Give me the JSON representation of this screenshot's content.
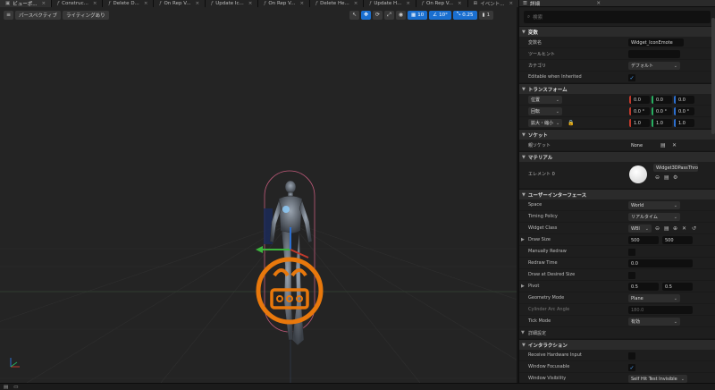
{
  "tabs": [
    {
      "label": "ビューポ...",
      "active": true,
      "icon": "viewport-icon"
    },
    {
      "label": "Construc...",
      "icon": "function-icon"
    },
    {
      "label": "Delete D...",
      "icon": "function-icon"
    },
    {
      "label": "On Rep V...",
      "icon": "function-icon"
    },
    {
      "label": "Update Ic...",
      "icon": "function-icon"
    },
    {
      "label": "On Rep V...",
      "icon": "function-icon"
    },
    {
      "label": "Delete He...",
      "icon": "function-icon"
    },
    {
      "label": "Update H...",
      "icon": "function-icon"
    },
    {
      "label": "On Rep V...",
      "icon": "function-icon"
    },
    {
      "label": "イベント...",
      "icon": "event-graph-icon"
    }
  ],
  "viewport": {
    "perspective_label": "パースペクティブ",
    "lighting_label": "ライティングあり",
    "grid_snap": "10",
    "rotation_snap": "10°",
    "scale_snap": "0.25",
    "camera_speed": "1"
  },
  "details": {
    "tab_label": "詳細",
    "search_placeholder": "検索",
    "sections": {
      "variables": "変数",
      "transform": "トランスフォーム",
      "socket": "ソケット",
      "material": "マテリアル",
      "user_interface": "ユーザーインターフェース",
      "interaction": "インタラクション"
    },
    "variable_name_label": "変数名",
    "variable_name_value": "Widget_IconEmote",
    "tooltip_label": "ツールヒント",
    "category_label": "カテゴリ",
    "category_value": "デフォルト",
    "editable_label": "Editable when Inherited",
    "location_label": "位置",
    "location": [
      "0.0",
      "0.0",
      "0.0"
    ],
    "rotation_label": "回転",
    "rotation": [
      "0.0 °",
      "0.0 °",
      "0.0 °"
    ],
    "scale_label": "拡大・縮小",
    "scale": [
      "1.0",
      "1.0",
      "1.0"
    ],
    "parent_socket_label": "親ソケット",
    "parent_socket_value": "None",
    "element0_label": "エレメント 0",
    "material_value": "Widget3DPassThro",
    "space_label": "Space",
    "space_value": "World",
    "timing_label": "Timing Policy",
    "timing_value": "リアルタイム",
    "widget_class_label": "Widget Class",
    "widget_class_value": "WBI",
    "draw_size_label": "Draw Size",
    "draw_size": [
      "500",
      "500"
    ],
    "manual_redraw_label": "Manually Redraw",
    "redraw_time_label": "Redraw Time",
    "redraw_time_value": "0.0",
    "draw_desired_label": "Draw at Desired Size",
    "pivot_label": "Pivot",
    "pivot": [
      "0.5",
      "0.5"
    ],
    "geometry_mode_label": "Geometry Mode",
    "geometry_mode_value": "Plane",
    "cylinder_arc_label": "Cylinder Arc Angle",
    "cylinder_arc_value": "180.0",
    "tick_mode_label": "Tick Mode",
    "tick_mode_value": "有効",
    "advanced_label": "詳細設定",
    "receive_hw_label": "Receive Hardware Input",
    "window_focusable_label": "Window Focusable",
    "window_visibility_label": "Window Visibility",
    "window_visibility_value": "Self Hit Test Invisible"
  },
  "colors": {
    "accent": "#1a6fd0",
    "widget_orange": "#e8780c",
    "panel_bg": "#1e1e1e"
  }
}
